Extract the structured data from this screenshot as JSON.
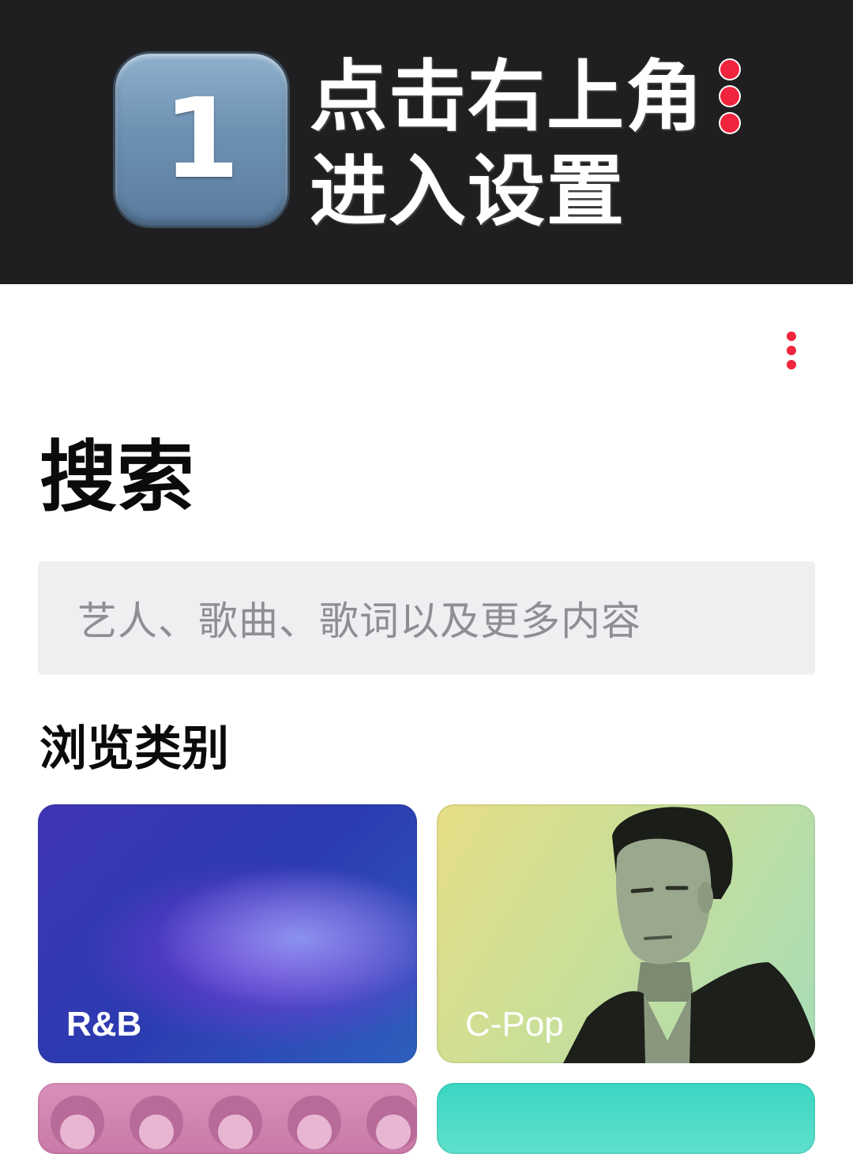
{
  "banner": {
    "step_number": "1",
    "line1": "点击右上角",
    "line2": "进入设置",
    "dots_icon": "vertical-ellipsis-icon"
  },
  "header": {
    "more_icon": "vertical-ellipsis-icon"
  },
  "page": {
    "title": "搜索"
  },
  "search": {
    "placeholder": "艺人、歌曲、歌词以及更多内容"
  },
  "browse": {
    "section_title": "浏览类别",
    "categories": [
      {
        "label": "R&B"
      },
      {
        "label": "C-Pop"
      },
      {
        "label": ""
      },
      {
        "label": ""
      }
    ]
  },
  "colors": {
    "accent": "#f0243c",
    "banner_bg": "#1f1f21",
    "search_bg": "#eeeff0"
  }
}
